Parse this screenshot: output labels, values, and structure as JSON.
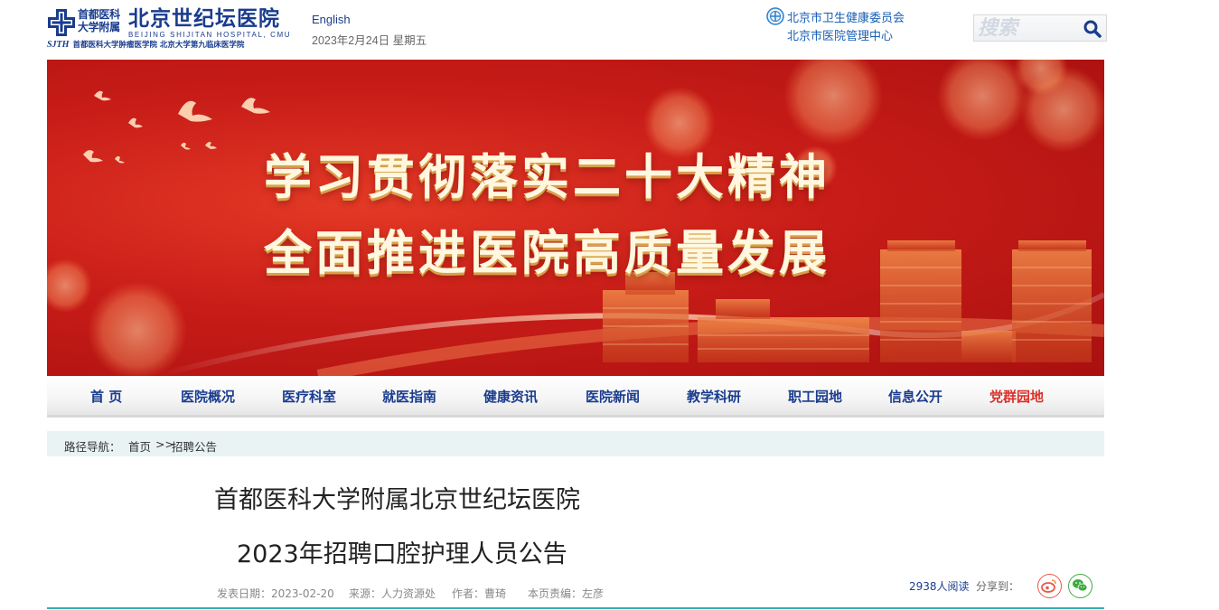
{
  "header": {
    "logo": {
      "cn_small_line1": "首都医科",
      "cn_small_line2": "大学附属",
      "cn_big": "北京世纪坛医院",
      "en": "BEIJING SHIJITAN HOSPITAL, CMU",
      "sith": "SJTH",
      "sub": "首都医科大学肿瘤医学院  北京大学第九临床医学院"
    },
    "english_link": "English",
    "date": "2023年2月24日 星期五",
    "gov_links": [
      "北京市卫生健康委员会",
      "北京市医院管理中心"
    ],
    "search": {
      "placeholder": "搜索"
    }
  },
  "banner": {
    "line1": "学习贯彻落实二十大精神",
    "line2": "全面推进医院高质量发展"
  },
  "nav": {
    "items": [
      "首 页",
      "医院概况",
      "医疗科室",
      "就医指南",
      "健康资讯",
      "医院新闻",
      "教学科研",
      "职工园地",
      "信息公开",
      "党群园地"
    ]
  },
  "breadcrumb": {
    "label": "路径导航：",
    "home": "首页",
    "sep": ">>",
    "current": "招聘公告"
  },
  "article": {
    "title_line1": "首都医科大学附属北京世纪坛医院",
    "title_line2": "2023年招聘口腔护理人员公告",
    "meta": {
      "date": "发表日期：2023-02-20",
      "source": "来源：人力资源处",
      "author": "作者：曹琦",
      "editor": "本页责编：左彦"
    },
    "reads": "2938人阅读",
    "share_label": "分享到："
  },
  "colors": {
    "brand_blue": "#1a3c8e",
    "banner_red": "#c81c18",
    "accent_red": "#d9322b",
    "teal": "#2fb3b1"
  }
}
